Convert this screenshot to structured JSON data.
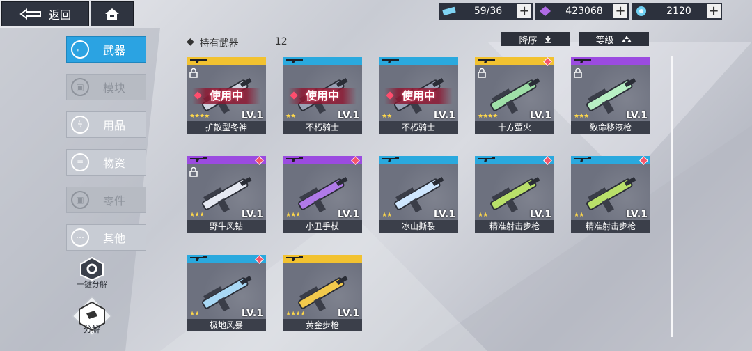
{
  "topbar": {
    "back_label": "返回",
    "resources": [
      {
        "icon": "stamina-icon",
        "value": "59/36",
        "plus": "+"
      },
      {
        "icon": "crystal-icon",
        "value": "423068",
        "plus": "+"
      },
      {
        "icon": "energy-orb-icon",
        "value": "2120",
        "plus": "+"
      }
    ]
  },
  "sidebar": {
    "items": [
      {
        "label": "武器",
        "icon": "gun-icon",
        "state": "active"
      },
      {
        "label": "模块",
        "icon": "lock-icon",
        "state": "locked"
      },
      {
        "label": "用品",
        "icon": "lightning-icon",
        "state": "normal"
      },
      {
        "label": "物资",
        "icon": "supplies-icon",
        "state": "normal"
      },
      {
        "label": "零件",
        "icon": "lock-icon",
        "state": "locked"
      },
      {
        "label": "其他",
        "icon": "more-icon",
        "state": "normal"
      }
    ],
    "dismantle_one_click": "一键分解",
    "dismantle": "分解"
  },
  "header": {
    "held_label": "持有武器",
    "held_count": "12",
    "sort_label": "降序",
    "level_label": "等级"
  },
  "weapons": [
    {
      "name": "扩散型冬神",
      "level": "LV.1",
      "stars": 4,
      "strip_color": "#f2c230",
      "in_use": true,
      "locked": true,
      "new": false,
      "in_use_label": "使用中"
    },
    {
      "name": "不朽骑士",
      "level": "LV.1",
      "stars": 2,
      "strip_color": "#2aa9de",
      "in_use": true,
      "locked": false,
      "new": false,
      "in_use_label": "使用中"
    },
    {
      "name": "不朽骑士",
      "level": "LV.1",
      "stars": 2,
      "strip_color": "#2aa9de",
      "in_use": true,
      "locked": false,
      "new": false,
      "in_use_label": "使用中"
    },
    {
      "name": "十方萤火",
      "level": "LV.1",
      "stars": 4,
      "strip_color": "#f2c230",
      "in_use": false,
      "locked": true,
      "new": true
    },
    {
      "name": "致命移液枪",
      "level": "LV.1",
      "stars": 3,
      "strip_color": "#9b4be0",
      "in_use": false,
      "locked": true,
      "new": false
    },
    {
      "name": "野牛风钻",
      "level": "LV.1",
      "stars": 3,
      "strip_color": "#9b4be0",
      "in_use": false,
      "locked": true,
      "new": true
    },
    {
      "name": "小丑手杖",
      "level": "LV.1",
      "stars": 3,
      "strip_color": "#9b4be0",
      "in_use": false,
      "locked": false,
      "new": true
    },
    {
      "name": "冰山撕裂",
      "level": "LV.1",
      "stars": 2,
      "strip_color": "#2aa9de",
      "in_use": false,
      "locked": false,
      "new": false
    },
    {
      "name": "精准射击步枪",
      "level": "LV.1",
      "stars": 2,
      "strip_color": "#2aa9de",
      "in_use": false,
      "locked": false,
      "new": true
    },
    {
      "name": "精准射击步枪",
      "level": "LV.1",
      "stars": 2,
      "strip_color": "#2aa9de",
      "in_use": false,
      "locked": false,
      "new": true
    },
    {
      "name": "极地风暴",
      "level": "LV.1",
      "stars": 2,
      "strip_color": "#2aa9de",
      "in_use": false,
      "locked": false,
      "new": true
    },
    {
      "name": "黄金步枪",
      "level": "LV.1",
      "stars": 4,
      "strip_color": "#f2c230",
      "in_use": false,
      "locked": false,
      "new": false
    }
  ]
}
